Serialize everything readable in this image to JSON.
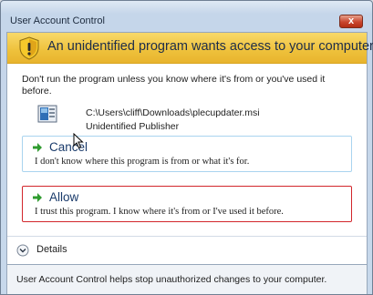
{
  "window": {
    "title": "User Account Control",
    "close_label": "x"
  },
  "banner": {
    "text": "An unidentified program wants access to your computer",
    "icon": "shield-warning-icon"
  },
  "warning_text": "Don't run the program unless you know where it's from or you've used it before.",
  "program": {
    "path": "C:\\Users\\cliff\\Downloads\\plecupdater.msi",
    "publisher": "Unidentified Publisher",
    "icon": "installer-file-icon"
  },
  "options": {
    "cancel": {
      "title": "Cancel",
      "description": "I don't know where this program is from or what it's for."
    },
    "allow": {
      "title": "Allow",
      "description": "I trust this program. I know where it's from or I've used it before."
    }
  },
  "details": {
    "label": "Details",
    "expanded": false
  },
  "footer": {
    "text": "User Account Control helps stop unauthorized changes to your computer."
  },
  "colors": {
    "banner": "#eec13b",
    "option_arrow": "#2f9b2f",
    "allow_highlight": "#d2262b",
    "option_title": "#1a3b6b"
  }
}
